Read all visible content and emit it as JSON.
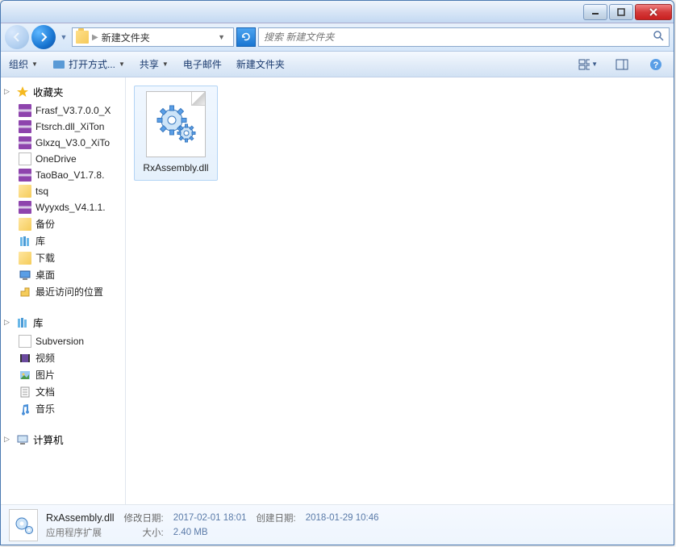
{
  "breadcrumb": {
    "label": "新建文件夹"
  },
  "search": {
    "placeholder": "搜索 新建文件夹"
  },
  "toolbar": {
    "organize": "组织",
    "open_with": "打开方式...",
    "share": "共享",
    "email": "电子邮件",
    "new_folder": "新建文件夹"
  },
  "sidebar": {
    "favorites": {
      "label": "收藏夹",
      "items": [
        {
          "label": "Frasf_V3.7.0.0_X",
          "icon": "rar"
        },
        {
          "label": "Ftsrch.dll_XiTon",
          "icon": "rar"
        },
        {
          "label": "Glxzq_V3.0_XiTo",
          "icon": "rar"
        },
        {
          "label": "OneDrive",
          "icon": "generic"
        },
        {
          "label": "TaoBao_V1.7.8.",
          "icon": "rar"
        },
        {
          "label": "tsq",
          "icon": "folder"
        },
        {
          "label": "Wyyxds_V4.1.1.",
          "icon": "rar"
        },
        {
          "label": "备份",
          "icon": "folder"
        },
        {
          "label": "库",
          "icon": "lib"
        },
        {
          "label": "下载",
          "icon": "folder"
        },
        {
          "label": "桌面",
          "icon": "desktop"
        },
        {
          "label": "最近访问的位置",
          "icon": "recent"
        }
      ]
    },
    "libraries": {
      "label": "库",
      "items": [
        {
          "label": "Subversion",
          "icon": "generic"
        },
        {
          "label": "视频",
          "icon": "video"
        },
        {
          "label": "图片",
          "icon": "picture"
        },
        {
          "label": "文档",
          "icon": "doc"
        },
        {
          "label": "音乐",
          "icon": "music"
        }
      ]
    },
    "computer": {
      "label": "计算机"
    }
  },
  "file": {
    "name": "RxAssembly.dll"
  },
  "details": {
    "name": "RxAssembly.dll",
    "type": "应用程序扩展",
    "mod_label": "修改日期:",
    "mod_val": "2017-02-01 18:01",
    "size_label": "大小:",
    "size_val": "2.40 MB",
    "create_label": "创建日期:",
    "create_val": "2018-01-29 10:46"
  }
}
